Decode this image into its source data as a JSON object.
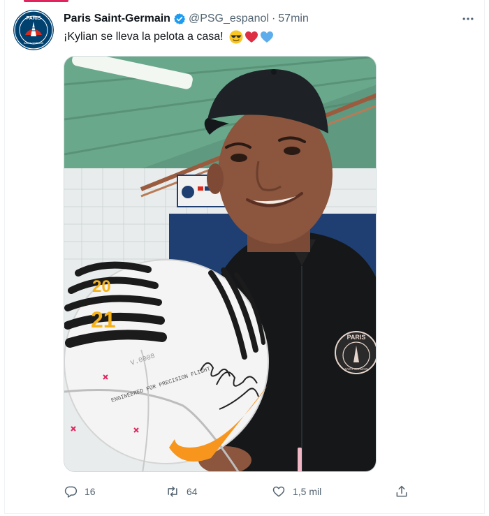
{
  "tweet": {
    "display_name": "Paris Saint-Germain",
    "handle": "@PSG_espanol",
    "separator": "·",
    "time": "57min",
    "text": "¡Kylian se lleva la pelota a casa!",
    "emojis": [
      "smiling-face-with-sunglasses",
      "red-heart",
      "blue-heart"
    ],
    "avatar": {
      "label_top": "PARIS",
      "label_bottom": "SAINT-GERMAIN"
    },
    "media": {
      "ball_year_top": "20",
      "ball_year_bottom": "21",
      "ball_text_1": "ENGINEERED FOR PRECISION FLIGHT",
      "ball_text_2": "V.0008",
      "jacket_badge_top": "PARIS",
      "jacket_badge_bottom": "SAINT-GERMAIN"
    }
  },
  "actions": {
    "reply_count": "16",
    "retweet_count": "64",
    "like_count": "1,5 mil"
  },
  "colors": {
    "accent": "#1d9bf0",
    "psg_navy": "#004170",
    "psg_red": "#da291c",
    "secondary_text": "#536471"
  }
}
